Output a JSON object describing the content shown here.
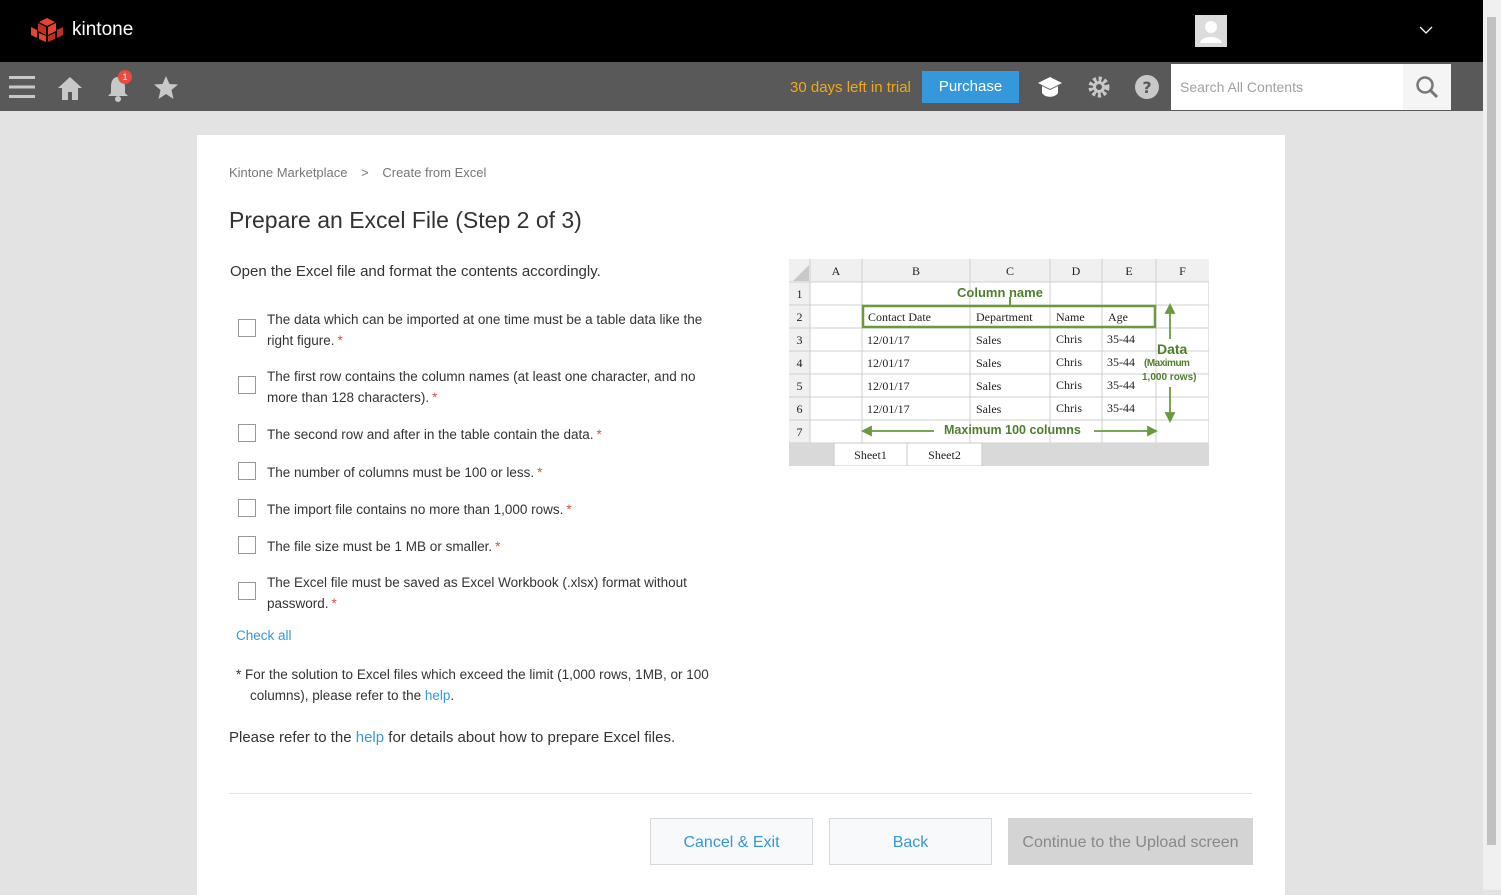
{
  "app": {
    "name": "kintone"
  },
  "nav": {
    "notification_count": "1",
    "trial_text": "30 days left in trial",
    "purchase_label": "Purchase",
    "search_placeholder": "Search All Contents"
  },
  "breadcrumb": {
    "items": [
      "Kintone Marketplace",
      "Create from Excel"
    ],
    "separator": ">"
  },
  "page": {
    "title": "Prepare an Excel File (Step 2 of 3)",
    "intro": "Open the Excel file and format the contents accordingly.",
    "checklist": [
      "The data which can be imported at one time must be a table data like the right figure.",
      "The first row contains the column names (at least one character, and no more than 128 characters).",
      "The second row and after in the table contain the data.",
      "The number of columns must be 100 or less.",
      "The import file contains no more than 1,000 rows.",
      "The file size must be 1 MB or smaller.",
      "The Excel file must be saved as Excel Workbook (.xlsx) format without password."
    ],
    "required_mark": "*",
    "check_all": "Check all",
    "note_prefix": "* For the solution to Excel files which exceed the limit (1,000 rows, 1MB, or 100 columns), please refer to the",
    "note_link": "help",
    "note_suffix": ".",
    "help_prefix": "Please refer to the",
    "help_link": "help",
    "help_suffix": "for details about how to prepare Excel files."
  },
  "figure": {
    "columns": [
      "A",
      "B",
      "C",
      "D",
      "E",
      "F"
    ],
    "rows": [
      "1",
      "2",
      "3",
      "4",
      "5",
      "6",
      "7"
    ],
    "headers": [
      "Contact Date",
      "Department",
      "Name",
      "Age"
    ],
    "data_rows": [
      [
        "12/01/17",
        "Sales",
        "Chris",
        "35-44"
      ],
      [
        "12/01/17",
        "Sales",
        "Chris",
        "35-44"
      ],
      [
        "12/01/17",
        "Sales",
        "Chris",
        "35-44"
      ],
      [
        "12/01/17",
        "Sales",
        "Chris",
        "35-44"
      ]
    ],
    "column_name_label": "Column name",
    "data_label": "Data",
    "data_sub1": "(Maximum",
    "data_sub2": "1,000 rows)",
    "max_columns_label": "Maximum 100 columns",
    "sheets": [
      "Sheet1",
      "Sheet2"
    ],
    "accent_color": "#4f7f2c"
  },
  "buttons": {
    "cancel": "Cancel & Exit",
    "back": "Back",
    "continue": "Continue to the Upload screen"
  },
  "colors": {
    "accent": "#3498db",
    "trial": "#f0a917",
    "required": "#e74c3c"
  }
}
